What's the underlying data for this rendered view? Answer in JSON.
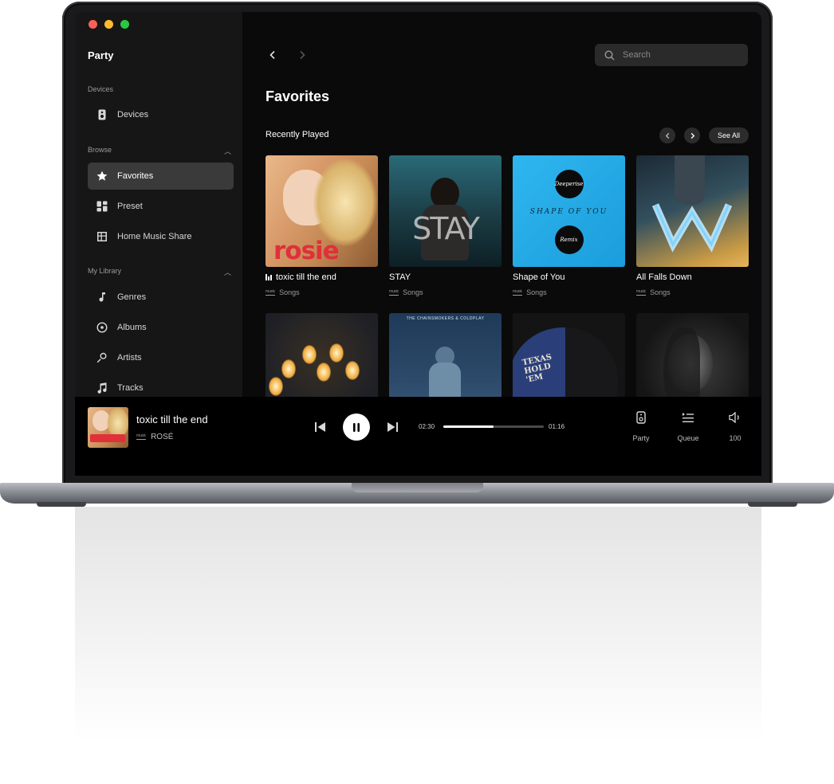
{
  "app": {
    "title": "Party"
  },
  "sidebar": {
    "devices_heading": "Devices",
    "devices_item": "Devices",
    "browse_heading": "Browse",
    "browse_items": [
      "Favorites",
      "Preset",
      "Home Music Share"
    ],
    "library_heading": "My Library",
    "library_items": [
      "Genres",
      "Albums",
      "Artists",
      "Tracks"
    ],
    "active_item": "Favorites"
  },
  "search": {
    "placeholder": "Search"
  },
  "main": {
    "page_title": "Favorites",
    "section_title": "Recently Played",
    "see_all_label": "See All",
    "cards": [
      {
        "title": "toxic till the end",
        "subtitle": "Songs",
        "now_playing": true
      },
      {
        "title": "STAY",
        "subtitle": "Songs"
      },
      {
        "title": "Shape of You",
        "subtitle": "Songs"
      },
      {
        "title": "All Falls Down",
        "subtitle": "Songs"
      }
    ],
    "covers_row1_text": [
      "rosie",
      "STAY",
      "SHAPE OF YOU",
      "Deeperise",
      "Remix"
    ],
    "covers_row2_text": [
      "THE CHAINSMOKERS & COLDPLAY",
      "TEXAS HOLD 'EM"
    ]
  },
  "player": {
    "title": "toxic till the end",
    "artist": "ROSÉ",
    "elapsed": "02:30",
    "remaining": "01:16",
    "progress_fraction": 0.5,
    "party_label": "Party",
    "queue_label": "Queue",
    "volume_label": "100"
  },
  "colors": {
    "accent": "#ffffff",
    "sidebar_bg": "#161616",
    "main_bg": "#0a0a0a",
    "active_bg": "#3a3a3a"
  },
  "icons": [
    "search-icon",
    "star-icon",
    "preset-icon",
    "home-share-icon",
    "genres-icon",
    "albums-icon",
    "artists-icon",
    "tracks-icon",
    "speaker-icon",
    "queue-icon",
    "volume-icon"
  ]
}
